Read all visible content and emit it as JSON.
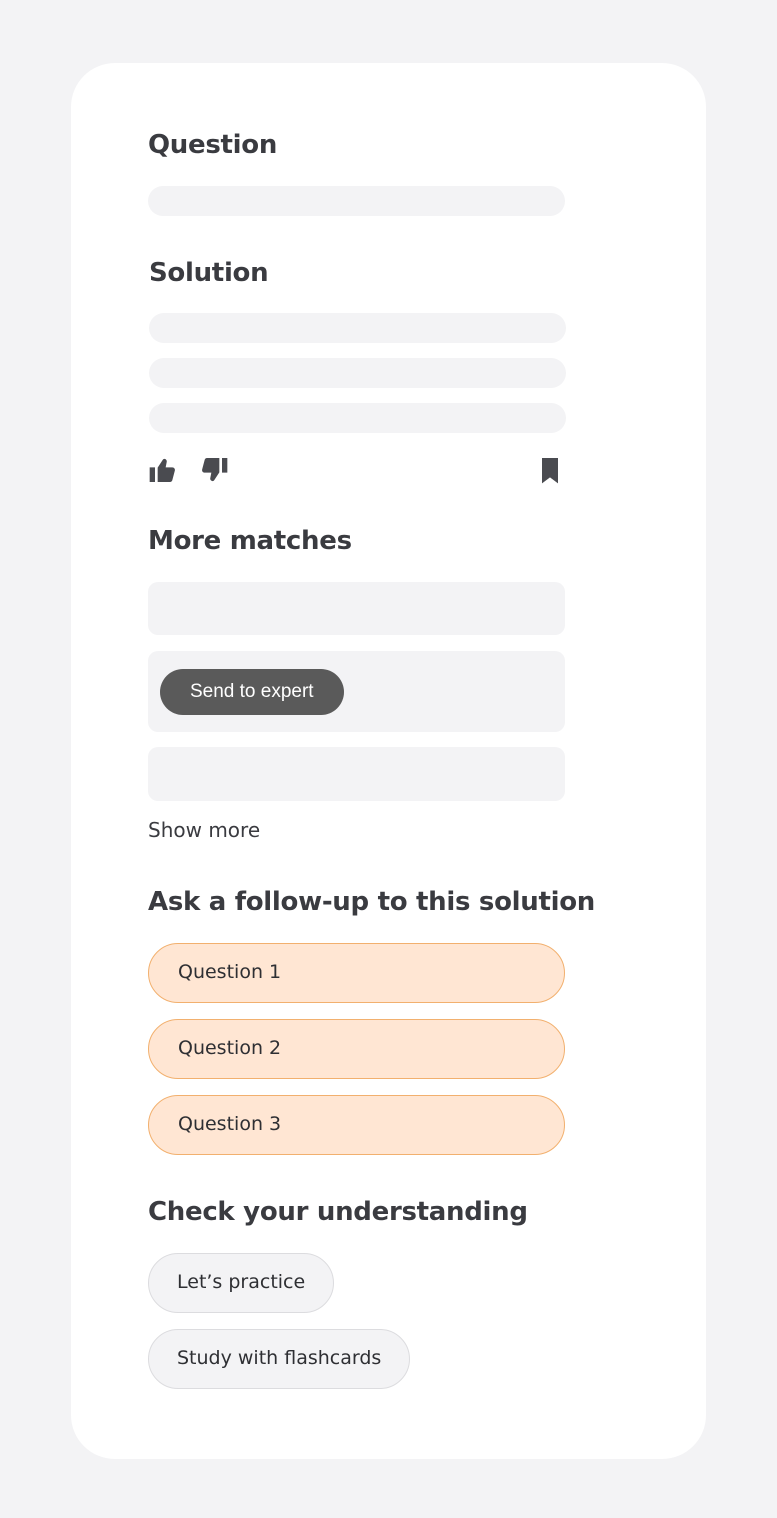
{
  "question": {
    "heading": "Question"
  },
  "solution": {
    "heading": "Solution"
  },
  "feedback": {
    "like_icon": "thumbs-up-icon",
    "dislike_icon": "thumbs-down-icon",
    "bookmark_icon": "bookmark-icon"
  },
  "more_matches": {
    "heading": "More matches",
    "send_to_expert_label": "Send to expert",
    "show_more_label": "Show more"
  },
  "follow_up": {
    "heading": "Ask a follow-up to this solution",
    "questions": [
      "Question 1",
      "Question 2",
      "Question 3"
    ]
  },
  "check_understanding": {
    "heading": "Check your understanding",
    "practice_label": "Let’s practice",
    "flashcards_label": "Study with flashcards"
  },
  "colors": {
    "page_background": "#f3f3f5",
    "card_background": "#ffffff",
    "skeleton": "#f3f3f5",
    "send_button": "#5a5a5a",
    "followup_fill": "#ffe6d3",
    "followup_border": "#f2b06e",
    "text": "#3a3b40"
  }
}
